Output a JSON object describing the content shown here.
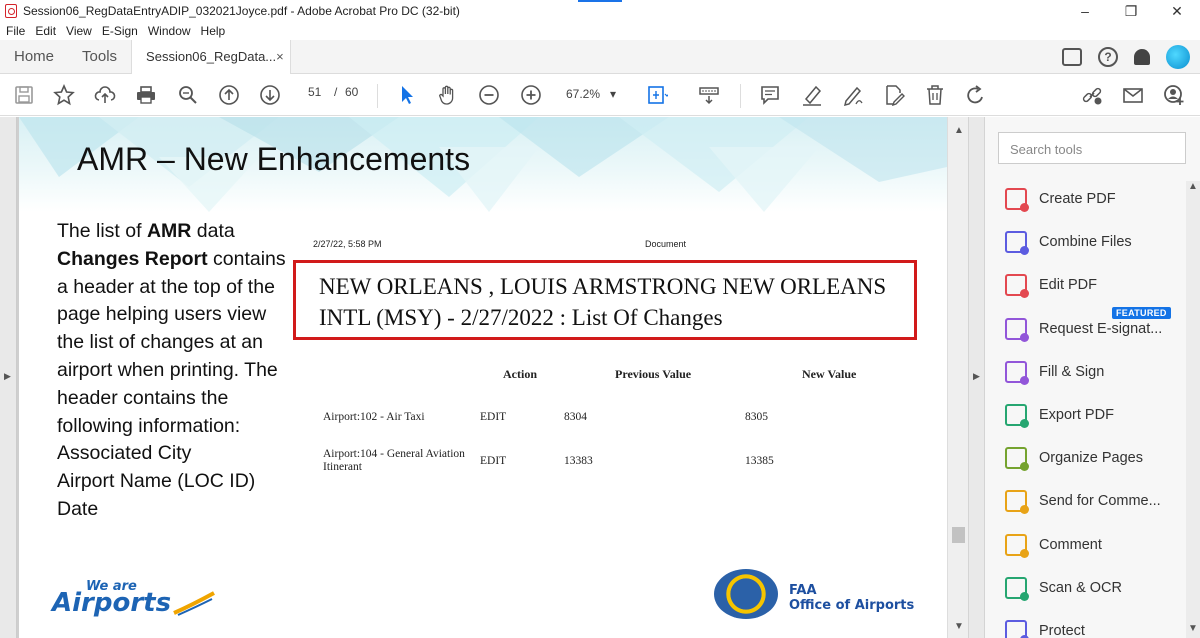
{
  "window": {
    "title": "Session06_RegDataEntryADIP_032021Joyce.pdf - Adobe Acrobat Pro DC (32-bit)",
    "minimize": "–",
    "restore": "❐",
    "close": "✕"
  },
  "menu": [
    "File",
    "Edit",
    "View",
    "E-Sign",
    "Window",
    "Help"
  ],
  "tabs": {
    "home": "Home",
    "tools": "Tools",
    "doc": "Session06_RegData...",
    "doc_close": "×"
  },
  "header_icons": [
    "share-screen-icon",
    "help-icon",
    "bell-icon",
    "avatar"
  ],
  "toolbar": {
    "page_current": "51",
    "page_sep": "/",
    "page_total": "60",
    "zoom": "67.2%",
    "zoom_caret": "▾"
  },
  "slide": {
    "title": "AMR – New Enhancements",
    "body_pre": "The list of ",
    "body_bold1": "AMR",
    "body_mid": " data ",
    "body_bold2": "Changes Report",
    "body_post": " contains a header at the top of the page helping users view the list of changes at an airport when printing.  The header contains the following information:",
    "list": [
      "Associated City",
      "Airport Name (LOC ID)",
      "Date"
    ]
  },
  "report": {
    "timestamp": "2/27/22, 5:58 PM",
    "doc_label": "Document",
    "heading_line1": "NEW ORLEANS , LOUIS ARMSTRONG NEW ORLEANS",
    "heading_line2": "INTL (MSY) - 2/27/2022 : List Of Changes",
    "columns": {
      "action": "Action",
      "previous": "Previous Value",
      "new": "New Value"
    },
    "rows": [
      {
        "field": "Airport:102 - Air Taxi",
        "action": "EDIT",
        "previous": "8304",
        "new": "8305"
      },
      {
        "field": "Airport:104 - General Aviation Itinerant",
        "action": "EDIT",
        "previous": "13383",
        "new": "13385"
      }
    ]
  },
  "footer": {
    "logo_small": "We are",
    "logo_large": "Airports",
    "faa_line1": "FAA",
    "faa_line2": "Office of Airports"
  },
  "tools_pane": {
    "search_placeholder": "Search tools",
    "featured_badge": "FEATURED",
    "items": [
      {
        "label": "Create PDF",
        "icon": "create-pdf-icon",
        "color": "#e34850"
      },
      {
        "label": "Combine Files",
        "icon": "combine-files-icon",
        "color": "#5c5ce0"
      },
      {
        "label": "Edit PDF",
        "icon": "edit-pdf-icon",
        "color": "#e34850"
      },
      {
        "label": "Request E-signat...",
        "icon": "request-esign-icon",
        "color": "#9256d9"
      },
      {
        "label": "Fill & Sign",
        "icon": "fill-sign-icon",
        "color": "#9256d9"
      },
      {
        "label": "Export PDF",
        "icon": "export-pdf-icon",
        "color": "#26a671"
      },
      {
        "label": "Organize Pages",
        "icon": "organize-pages-icon",
        "color": "#75a32f"
      },
      {
        "label": "Send for Comme...",
        "icon": "send-comment-icon",
        "color": "#e8a317"
      },
      {
        "label": "Comment",
        "icon": "comment-icon",
        "color": "#e8a317"
      },
      {
        "label": "Scan & OCR",
        "icon": "scan-ocr-icon",
        "color": "#26a671"
      },
      {
        "label": "Protect",
        "icon": "protect-icon",
        "color": "#5c5ce0"
      }
    ]
  }
}
